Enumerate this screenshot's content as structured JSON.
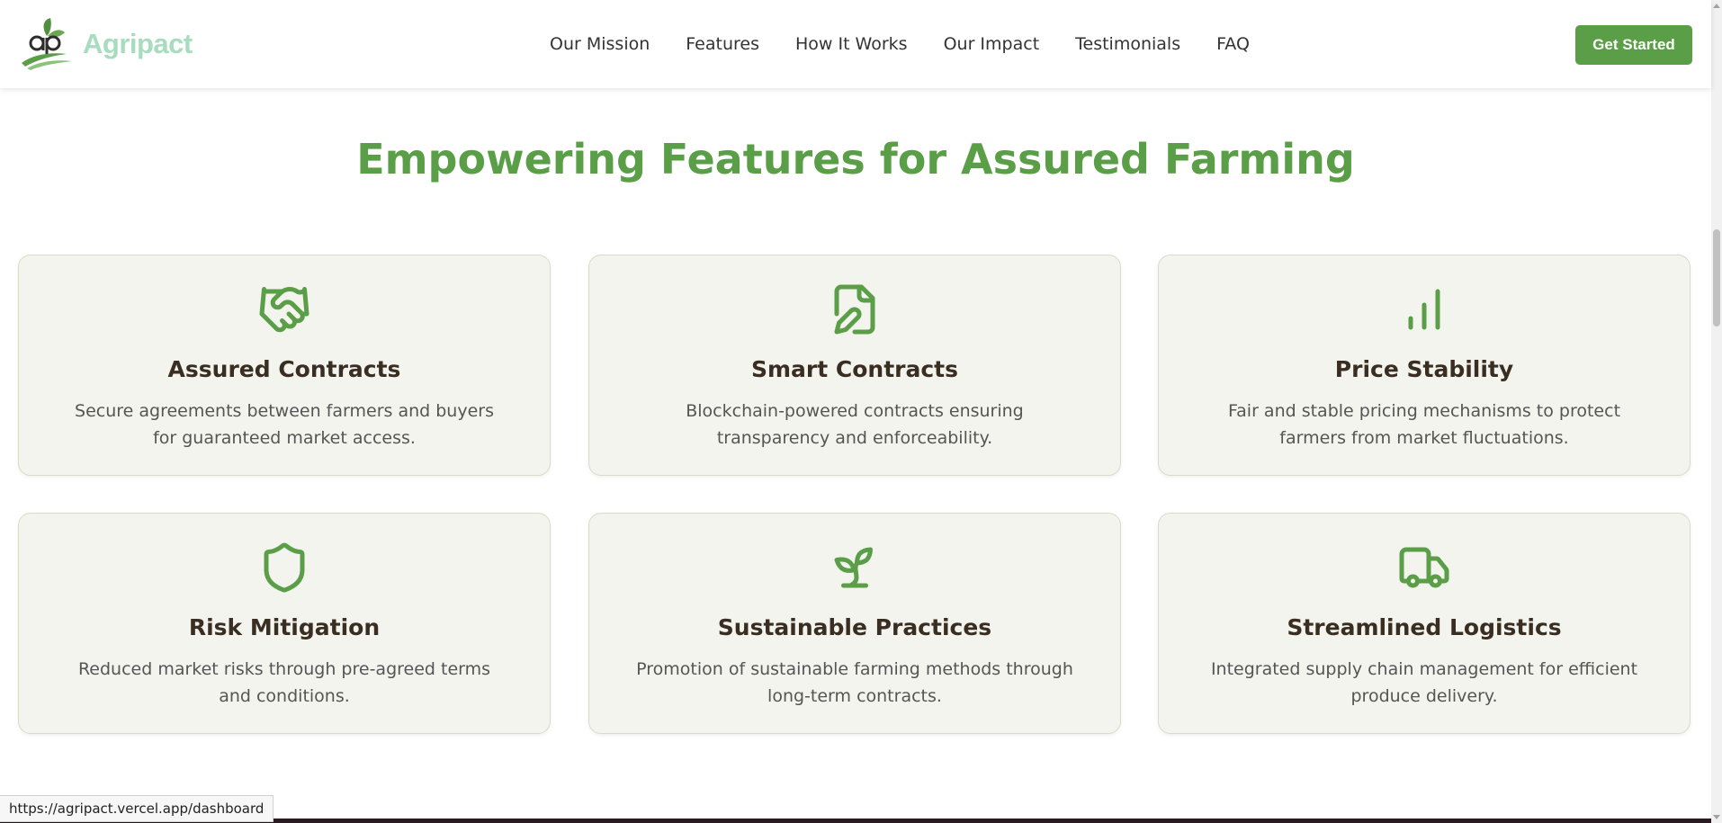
{
  "brand": {
    "name": "Agripact",
    "logo_icon": "agripact-logo-icon"
  },
  "nav": {
    "links": [
      "Our Mission",
      "Features",
      "How It Works",
      "Our Impact",
      "Testimonials",
      "FAQ"
    ],
    "cta_label": "Get Started"
  },
  "section": {
    "title": "Empowering Features for Assured Farming"
  },
  "features": [
    {
      "icon": "handshake-icon",
      "title": "Assured Contracts",
      "desc": "Secure agreements between farmers and buyers for guaranteed market access."
    },
    {
      "icon": "signed-document-icon",
      "title": "Smart Contracts",
      "desc": "Blockchain-powered contracts ensuring transparency and enforceability."
    },
    {
      "icon": "bar-chart-icon",
      "title": "Price Stability",
      "desc": "Fair and stable pricing mechanisms to protect farmers from market fluctuations."
    },
    {
      "icon": "shield-icon",
      "title": "Risk Mitigation",
      "desc": "Reduced market risks through pre-agreed terms and conditions."
    },
    {
      "icon": "sprout-icon",
      "title": "Sustainable Practices",
      "desc": "Promotion of sustainable farming methods through long-term contracts."
    },
    {
      "icon": "truck-icon",
      "title": "Streamlined Logistics",
      "desc": "Integrated supply chain management for efficient produce delivery."
    }
  ],
  "status_bar": {
    "url": "https://agripact.vercel.app/dashboard"
  },
  "colors": {
    "accent": "#5a9e47",
    "logo_text": "#a8dcbf",
    "card_bg": "#f4f4ef",
    "card_border": "#dadbc6",
    "heading": "#3a2e22"
  }
}
